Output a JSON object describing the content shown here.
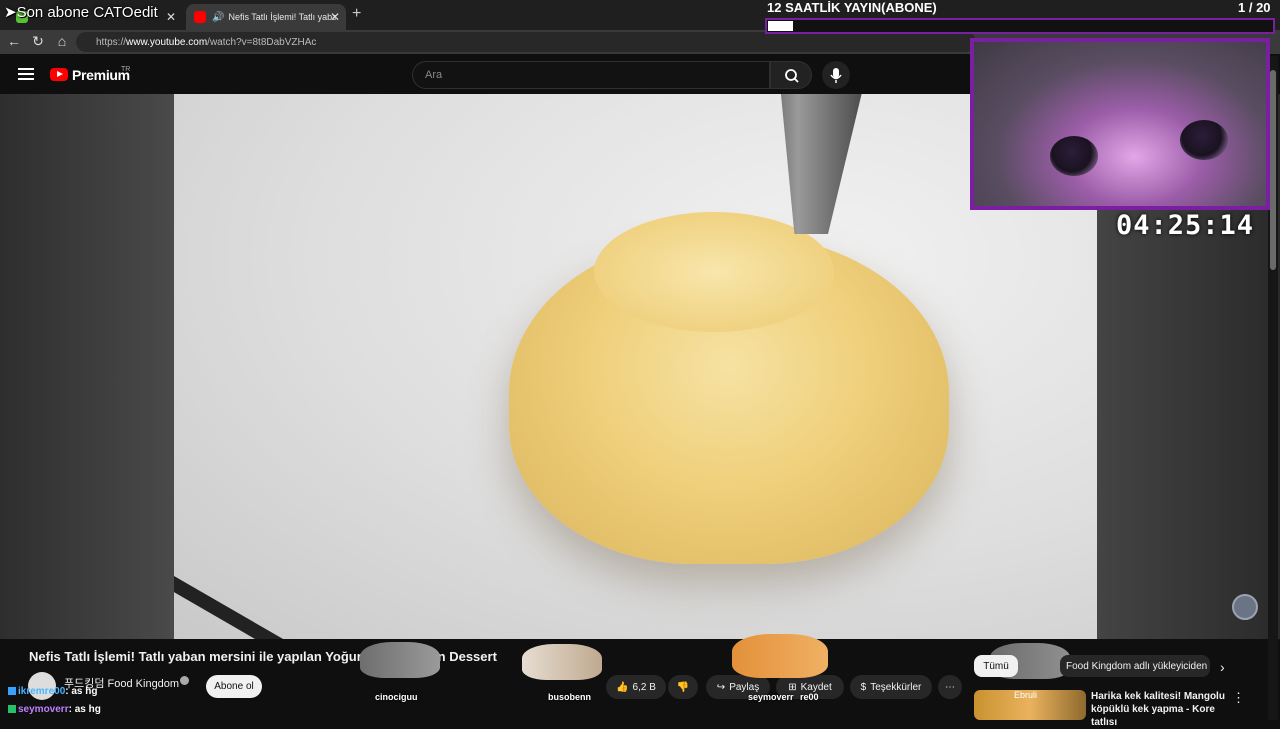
{
  "browser": {
    "tabs": [
      {
        "label": "Son abone CATOedit"
      },
      {
        "label": "Nefis Tatlı İşlemi! Tatlı yaban m"
      }
    ],
    "url_prefix": "https://",
    "url_host": "www.youtube.com",
    "url_path": "/watch?v=8t8DabVZHAc"
  },
  "youtube": {
    "brand": "Premium",
    "brand_region": "TR",
    "search_placeholder": "Ara"
  },
  "stream_overlay": {
    "live_title": "12 SAATLİK YAYIN(ABONE)",
    "sub_count": "1 / 20",
    "goal_fraction": 0.05,
    "timer": "04:25:14",
    "accent_color": "#7a1fa2",
    "title_overlay": "Son abone CATOedit"
  },
  "video": {
    "title": "Nefis Tatlı İşlemi! Tatlı yaban mersini ile yapılan Yoğurt K... / Korean Dessert",
    "channel": "푸드킹덤 Food Kingdom",
    "subscribe_label": "Abone ol",
    "like_count": "6,2 B",
    "share_label": "Paylaş",
    "save_label": "Kaydet",
    "thanks_label": "Teşekkürler",
    "more_label": "⋯"
  },
  "cat_overlays": [
    {
      "name": "cinociguu"
    },
    {
      "name": "busobenn"
    },
    {
      "name": "seymoverr"
    },
    {
      "name": "re00"
    }
  ],
  "chat": [
    {
      "user": "ikremre00",
      "message": ": as hg"
    },
    {
      "user": "seymoverr",
      "message": ": as hg"
    }
  ],
  "recommendations": {
    "chip_all": "Tümü",
    "chip_upload": "Food Kingdom adlı yükleyiciden",
    "item_title": "Harika kek kalitesi! Mangolu köpüklü kek yapma - Kore tatlısı",
    "item_thumb_text": "Ebruli"
  }
}
